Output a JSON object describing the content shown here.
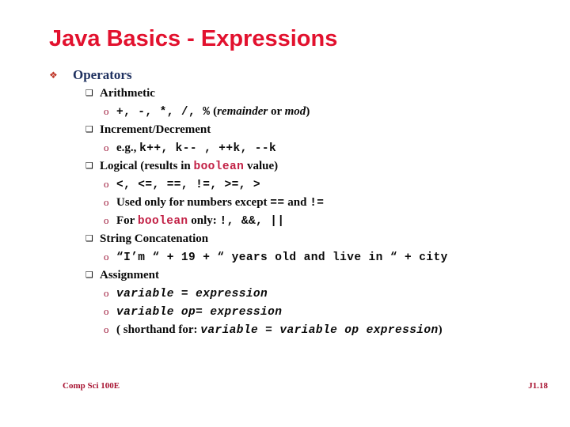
{
  "slide": {
    "title": "Java Basics - Expressions",
    "colors": {
      "title_red": "#E2112E",
      "heading_navy": "#1F3160",
      "bullet_maroon": "#9E1B3C",
      "code_red": "#C22045",
      "footer_red": "#A81432",
      "background": "#FFFFFF"
    },
    "bullets": {
      "level1_glyph": "❖",
      "level2_glyph": "❑",
      "level3_glyph": "o"
    },
    "outline": {
      "level1_label": "Operators",
      "groups": [
        {
          "heading_parts": [
            {
              "text": "Arithmetic",
              "style": "serif-bold"
            }
          ],
          "items": [
            {
              "parts": [
                {
                  "text": "+,  -,  *,  /,  %",
                  "style": "code"
                },
                {
                  "text": "  (",
                  "style": "serif-bold"
                },
                {
                  "text": "remainder",
                  "style": "serif-bold-italic"
                },
                {
                  "text": " or ",
                  "style": "serif-bold"
                },
                {
                  "text": "mod",
                  "style": "serif-bold-italic"
                },
                {
                  "text": ")",
                  "style": "serif-bold"
                }
              ]
            }
          ]
        },
        {
          "heading_parts": [
            {
              "text": "Increment/Decrement",
              "style": "serif-bold"
            }
          ],
          "items": [
            {
              "parts": [
                {
                  "text": "e.g., ",
                  "style": "serif-bold"
                },
                {
                  "text": "k++,  k--  ,  ++k,  --k",
                  "style": "code"
                }
              ]
            }
          ]
        },
        {
          "heading_parts": [
            {
              "text": "Logical (results in ",
              "style": "serif-bold"
            },
            {
              "text": "boolean",
              "style": "code-red"
            },
            {
              "text": " value)",
              "style": "serif-bold"
            }
          ],
          "items": [
            {
              "parts": [
                {
                  "text": "<,  <=,  ==,  !=,  >=,  >",
                  "style": "code"
                }
              ]
            },
            {
              "parts": [
                {
                  "text": "Used only for numbers except ",
                  "style": "serif-bold"
                },
                {
                  "text": "==",
                  "style": "code"
                },
                {
                  "text": " and ",
                  "style": "serif-bold"
                },
                {
                  "text": "!=",
                  "style": "code"
                }
              ]
            },
            {
              "parts": [
                {
                  "text": "For ",
                  "style": "serif-bold"
                },
                {
                  "text": "boolean",
                  "style": "code-red"
                },
                {
                  "text": " only: ",
                  "style": "serif-bold"
                },
                {
                  "text": "!,  &&,  ||",
                  "style": "code"
                }
              ]
            }
          ]
        },
        {
          "heading_parts": [
            {
              "text": "String Concatenation",
              "style": "serif-bold"
            }
          ],
          "items": [
            {
              "parts": [
                {
                  "text": "“I’m “ + 19 + “ years old and live in “ + city",
                  "style": "code"
                }
              ]
            }
          ]
        },
        {
          "heading_parts": [
            {
              "text": "Assignment",
              "style": "serif-bold"
            }
          ],
          "items": [
            {
              "parts": [
                {
                  "text": "variable = expression",
                  "style": "code-italic"
                }
              ]
            },
            {
              "parts": [
                {
                  "text": "variable op= expression",
                  "style": "code-italic"
                }
              ]
            },
            {
              "parts": [
                {
                  "text": "( shorthand for:  ",
                  "style": "serif-bold"
                },
                {
                  "text": "variable = variable op expression",
                  "style": "code-italic"
                },
                {
                  "text": ")",
                  "style": "serif-bold"
                }
              ]
            }
          ]
        }
      ]
    },
    "footer": {
      "course": "Comp Sci 100E",
      "page": "J1.18"
    }
  }
}
